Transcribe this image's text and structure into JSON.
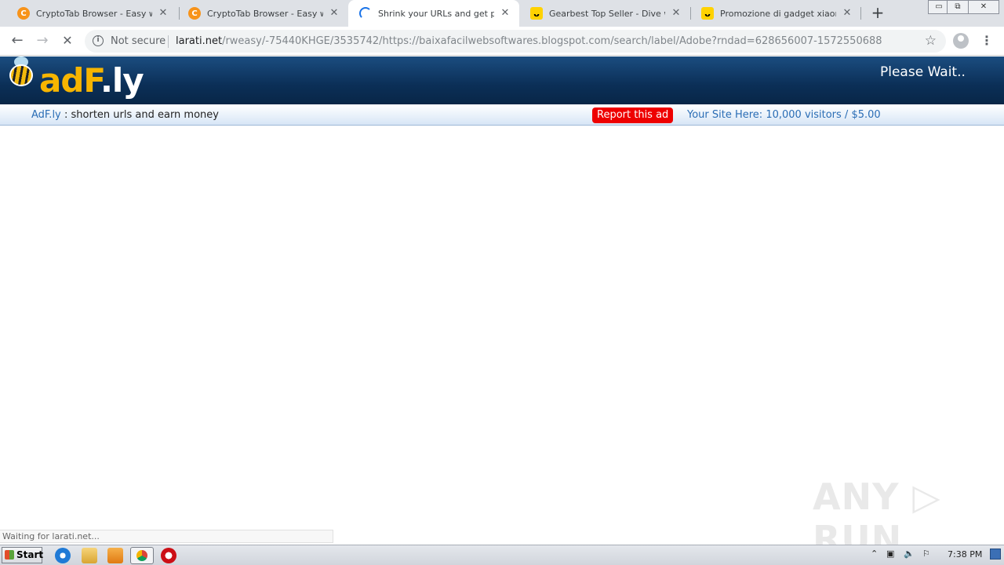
{
  "browser": {
    "tabs": [
      {
        "title": "CryptoTab Browser - Easy way to",
        "favicon": "cryptotab-icon",
        "active": false
      },
      {
        "title": "CryptoTab Browser - Easy way to",
        "favicon": "cryptotab-icon",
        "active": false
      },
      {
        "title": "Shrink your URLs and get paid!",
        "favicon": "loading-spinner-icon",
        "active": true
      },
      {
        "title": "Gearbest Top Seller - Dive with",
        "favicon": "gearbest-icon",
        "active": false
      },
      {
        "title": "Promozione di gadget xiaomi fino",
        "favicon": "gearbest-icon",
        "active": false
      }
    ],
    "new_tab": "+",
    "close_glyph": "✕",
    "window_controls": {
      "minimize": "▭",
      "restore": "⧉",
      "close": "✕"
    },
    "nav": {
      "back": "←",
      "forward": "→",
      "stop": "✕"
    },
    "omnibox": {
      "security": "Not secure",
      "host": "larati.net",
      "path": "/rweasy/-75440KHGE/3535742/https://baixafacilwebsoftwares.blogspot.com/search/label/Adobe?rndad=628656007-1572550688"
    },
    "status": "Waiting for larati.net..."
  },
  "page": {
    "logo": {
      "ad": "ad",
      "f": "F",
      "dot": ".",
      "ly": "ly"
    },
    "please_wait": "Please Wait..",
    "brand_link": "AdF.ly",
    "tagline": ": shorten urls and earn money",
    "report_button": "Report this ad",
    "your_site": "Your Site Here: 10,000 visitors / $5.00"
  },
  "watermark": "ANY ▷ RUN",
  "taskbar": {
    "start": "Start",
    "clock": "7:38 PM"
  }
}
